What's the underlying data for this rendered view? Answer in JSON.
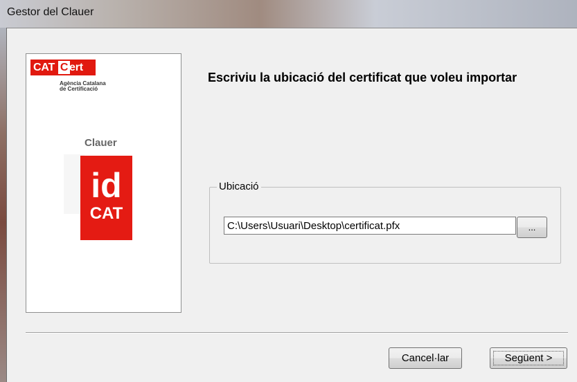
{
  "window": {
    "title": "Gestor del Clauer"
  },
  "branding": {
    "catcert_prefix": "CAT",
    "catcert_c": "C",
    "catcert_suffix": "ert",
    "agency_line1": "Agència Catalana",
    "agency_line2": "de Certificació",
    "clauer": "Clauer",
    "idcat_id": "id",
    "idcat_cat": "CAT"
  },
  "main": {
    "heading": "Escriviu la ubicació del certificat que voleu importar",
    "location_group": {
      "legend": "Ubicació",
      "path_value": "C:\\Users\\Usuari\\Desktop\\certificat.pfx",
      "browse_label": "..."
    }
  },
  "footer": {
    "cancel_label": "Cancel·lar",
    "next_label": "Següent >"
  },
  "colors": {
    "brand_red": "#e1190f",
    "dialog_background": "#f0f0f0"
  }
}
